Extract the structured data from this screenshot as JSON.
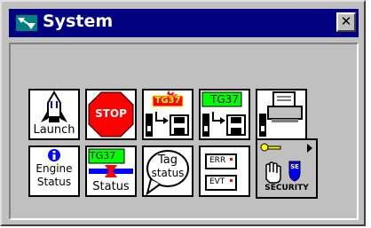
{
  "window": {
    "title": "System",
    "close_glyph": "✕"
  },
  "row1": {
    "launch": {
      "label": "Launch",
      "rocket_text": "BV"
    },
    "stop": {
      "label": "STOP"
    },
    "tg_alarm": {
      "badge": "TG37"
    },
    "tg_save": {
      "badge": "TG37"
    },
    "printer": {}
  },
  "row2": {
    "engine": {
      "line1": "Engine",
      "line2": "Status"
    },
    "tg_status": {
      "badge": "TG37",
      "label": "Status"
    },
    "tag_status": {
      "line1": "Tag",
      "line2": "status"
    },
    "err_evt": {
      "err": "ERR",
      "evt": "EVT"
    },
    "security": {
      "label": "SECURITY",
      "badge": "SE"
    }
  },
  "colors": {
    "titlebar": "#000080",
    "face": "#c0c0c0",
    "stop_red": "#ff0000",
    "tg_green": "#00ff00",
    "accent_blue": "#0000ff",
    "key_yellow": "#ffff00"
  }
}
